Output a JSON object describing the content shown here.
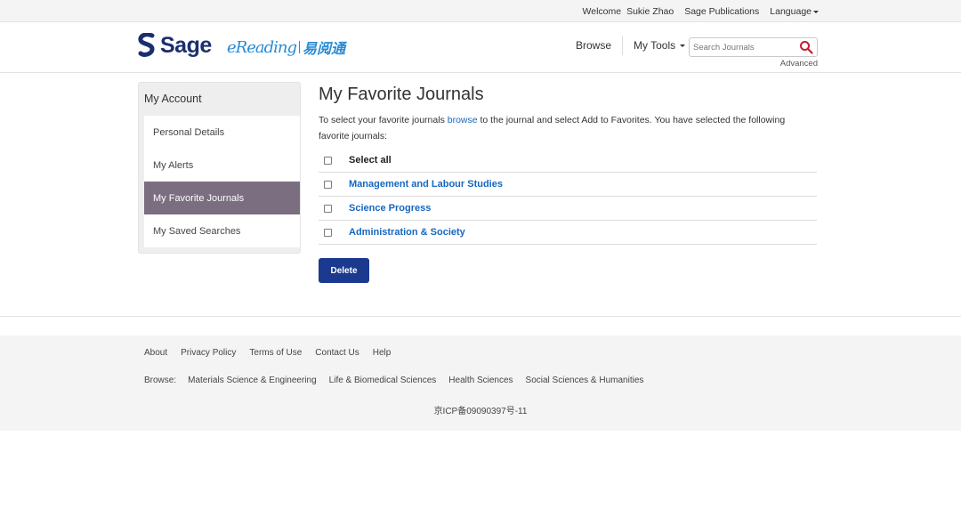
{
  "topbar": {
    "welcome": "Welcome",
    "user": "Sukie Zhao",
    "org": "Sage Publications",
    "language": "Language"
  },
  "header": {
    "logo_sage": "Sage",
    "logo_ereading_en": "eReading",
    "logo_ereading_cn": "易阅通",
    "nav_browse": "Browse",
    "nav_mytools": "My Tools",
    "search_placeholder": "Search Journals",
    "advanced": "Advanced"
  },
  "sidebar": {
    "title": "My Account",
    "items": [
      {
        "label": "Personal Details",
        "active": false
      },
      {
        "label": "My Alerts",
        "active": false
      },
      {
        "label": "My Favorite Journals",
        "active": true
      },
      {
        "label": "My Saved Searches",
        "active": false
      }
    ]
  },
  "main": {
    "title": "My Favorite Journals",
    "intro_before": "To select your favorite journals ",
    "intro_link": "browse",
    "intro_after": " to the journal and select Add to Favorites. You have selected the following favorite journals:",
    "select_all": "Select all",
    "journals": [
      "Management and Labour Studies",
      "Science Progress",
      "Administration & Society"
    ],
    "delete_label": "Delete"
  },
  "footer": {
    "links": [
      "About",
      "Privacy Policy",
      "Terms of Use",
      "Contact Us",
      "Help"
    ],
    "browse_label": "Browse:",
    "browse_links": [
      "Materials Science & Engineering",
      "Life & Biomedical Sciences",
      "Health Sciences",
      "Social Sciences & Humanities"
    ],
    "icp": "京ICP备09090397号-11"
  },
  "colors": {
    "brand_navy": "#1b2f6e",
    "link_blue": "#1667c0",
    "active_nav": "#7b6e80",
    "button_blue": "#1b3a8f",
    "search_icon": "#c0202e"
  }
}
